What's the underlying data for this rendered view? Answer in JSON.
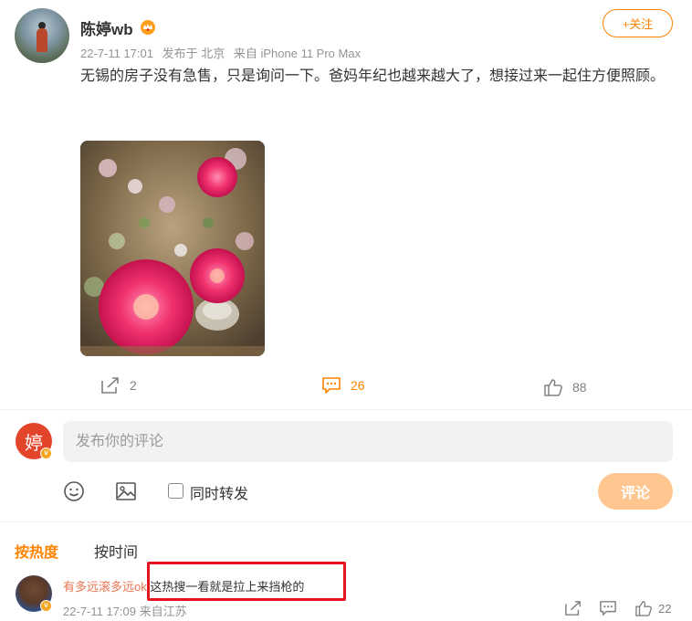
{
  "post": {
    "author": "陈婷wb",
    "author_badge_icon": "crown-badge-icon",
    "date": "22-7-11 17:01",
    "location": "发布于 北京",
    "device": "来自 iPhone 11 Pro Max",
    "follow_label": "+关注",
    "text": "无锡的房子没有急售，只是询问一下。爸妈年纪也越来越大了，想接过来一起住方便照顾。",
    "image_alt": "pink peony flowers",
    "actions": {
      "repost_count": "2",
      "comment_count": "26",
      "like_count": "88"
    }
  },
  "composer": {
    "avatar_char": "婷",
    "placeholder": "发布你的评论",
    "repost_label": "同时转发",
    "submit_label": "评论"
  },
  "sort": {
    "hot_label": "按热度",
    "time_label": "按时间"
  },
  "comments": [
    {
      "user": "有多远滚多远ok",
      "text": ":这热搜一看就是拉上来挡枪的",
      "date": "22-7-11 17:09",
      "location": "来自江苏",
      "like_count": "22"
    }
  ],
  "colors": {
    "accent": "#ff8200",
    "username_link": "#eb7350",
    "highlight_box": "#e5151d",
    "submit_disabled": "#ffc68f"
  }
}
